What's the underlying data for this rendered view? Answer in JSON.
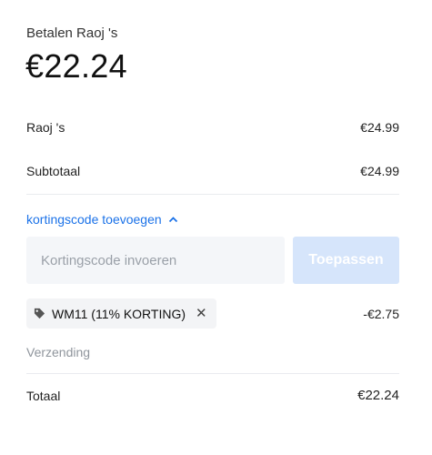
{
  "header": {
    "pay_label": "Betalen Raoj 's",
    "amount": "€22.24"
  },
  "line_item": {
    "label": "Raoj 's",
    "value": "€24.99"
  },
  "subtotal": {
    "label": "Subtotaal",
    "value": "€24.99"
  },
  "promo": {
    "toggle_label": "kortingscode toevoegen",
    "toggle_icon": "chevron-up-icon",
    "placeholder": "Kortingscode invoeren",
    "apply_label": "Toepassen",
    "accent_color": "#1b72e8",
    "button_disabled_color": "#d6e5fb"
  },
  "applied_code": {
    "icon": "tag-icon",
    "label": "WM11 (11% KORTING)",
    "remove_icon": "close-icon",
    "remove_glyph": "✕",
    "value": "-€2.75"
  },
  "shipping": {
    "label": "Verzending"
  },
  "total": {
    "label": "Totaal",
    "value": "€22.24"
  }
}
